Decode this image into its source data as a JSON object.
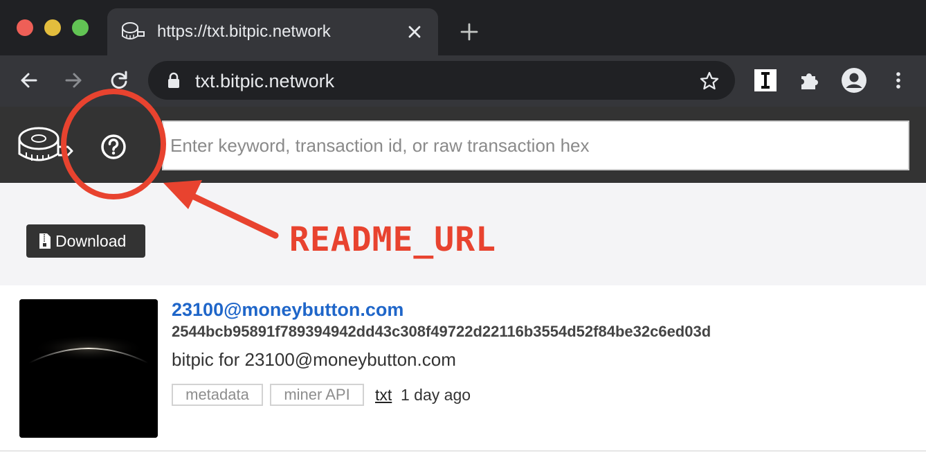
{
  "browser": {
    "tab_title": "https://txt.bitpic.network",
    "address": "txt.bitpic.network"
  },
  "toolbar_icons": [
    "back-arrow-icon",
    "forward-arrow-icon",
    "reload-icon",
    "lock-icon",
    "bookmark-star-icon",
    "instapaper-extension-icon",
    "extensions-puzzle-icon",
    "profile-icon",
    "more-menu-icon"
  ],
  "site": {
    "search_placeholder": "Enter keyword, transaction id, or raw transaction hex",
    "download_label": "Download"
  },
  "annotation": {
    "label": "README_URL",
    "color": "#e8432f"
  },
  "result": {
    "author": "23100@moneybutton.com",
    "txid": "2544bcb95891f789394942dd43c308f49722d22116b3554d52f84be32c6ed03d",
    "description": "bitpic for 23100@moneybutton.com",
    "tags": [
      "metadata",
      "miner API"
    ],
    "link": "txt",
    "time": "1 day ago"
  },
  "colors": {
    "link_blue": "#1f66c9",
    "header_dark": "#333333",
    "band_gray": "#f4f4f6"
  }
}
